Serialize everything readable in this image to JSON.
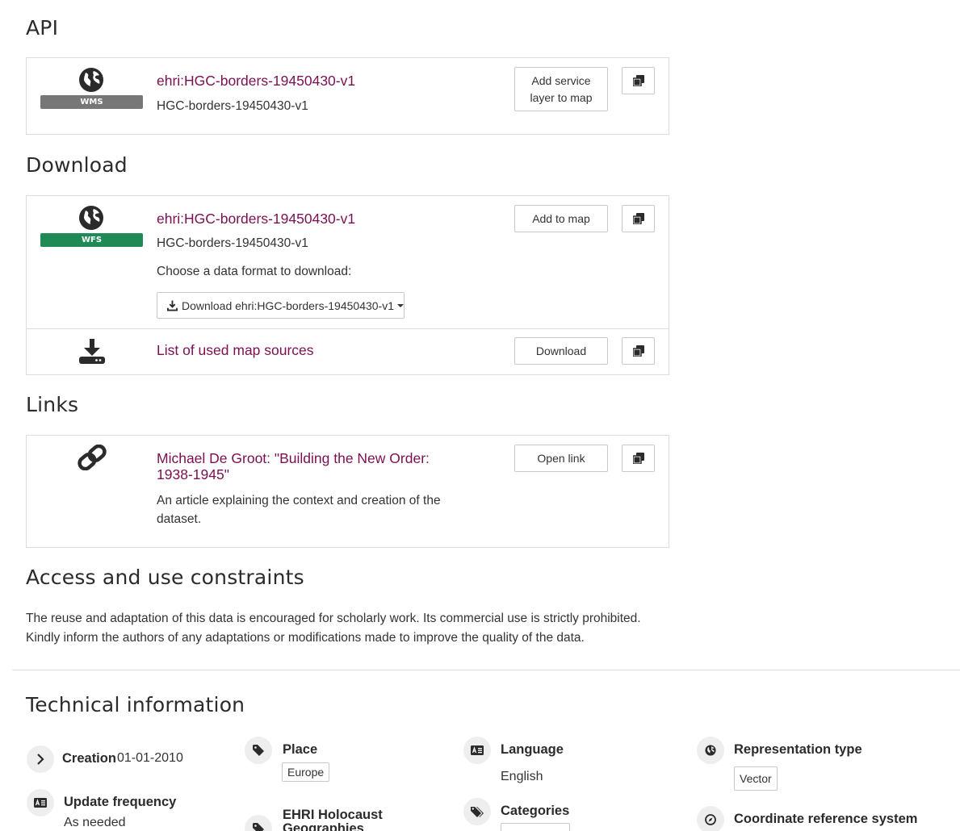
{
  "api": {
    "heading": "API",
    "item": {
      "badge": "WMS",
      "title": "ehri:HGC-borders-19450430-v1",
      "subtitle": "HGC-borders-19450430-v1",
      "button_line1": "Add service",
      "button_line2": "layer to map"
    }
  },
  "download": {
    "heading": "Download",
    "item": {
      "badge": "WFS",
      "title": "ehri:HGC-borders-19450430-v1",
      "subtitle": "HGC-borders-19450430-v1",
      "format_prompt": "Choose a data format to download:",
      "dropdown_label": "Download ehri:HGC-borders-19450430-v1",
      "button": "Add to map"
    },
    "sources": {
      "title": "List of used map sources",
      "button": "Download"
    }
  },
  "links": {
    "heading": "Links",
    "item": {
      "title_line1": "Michael De Groot: \"Building the New Order:",
      "title_line2": "1938-1945\"",
      "desc_line1": "An article explaining the context and creation of the",
      "desc_line2": "dataset.",
      "button": "Open link"
    }
  },
  "constraints": {
    "heading": "Access and use constraints",
    "line1": "The reuse and adaptation of this data is encouraged for scholarly work. Its commercial use is strictly prohibited.",
    "line2": "Kindly inform the authors of any adaptations or modifications made to improve the quality of the data."
  },
  "technical": {
    "heading": "Technical information",
    "creation_label": "Creation",
    "creation_value": "01-01-2010",
    "update_label": "Update frequency",
    "update_value": "As needed",
    "place_label": "Place",
    "place_tag": "Europe",
    "ehri_label_line1": "EHRI Holocaust",
    "ehri_label_line2": "Geographies",
    "language_label": "Language",
    "language_value": "English",
    "categories_label": "Categories",
    "representation_label": "Representation type",
    "representation_tag": "Vector",
    "crs_label": "Coordinate reference system"
  }
}
